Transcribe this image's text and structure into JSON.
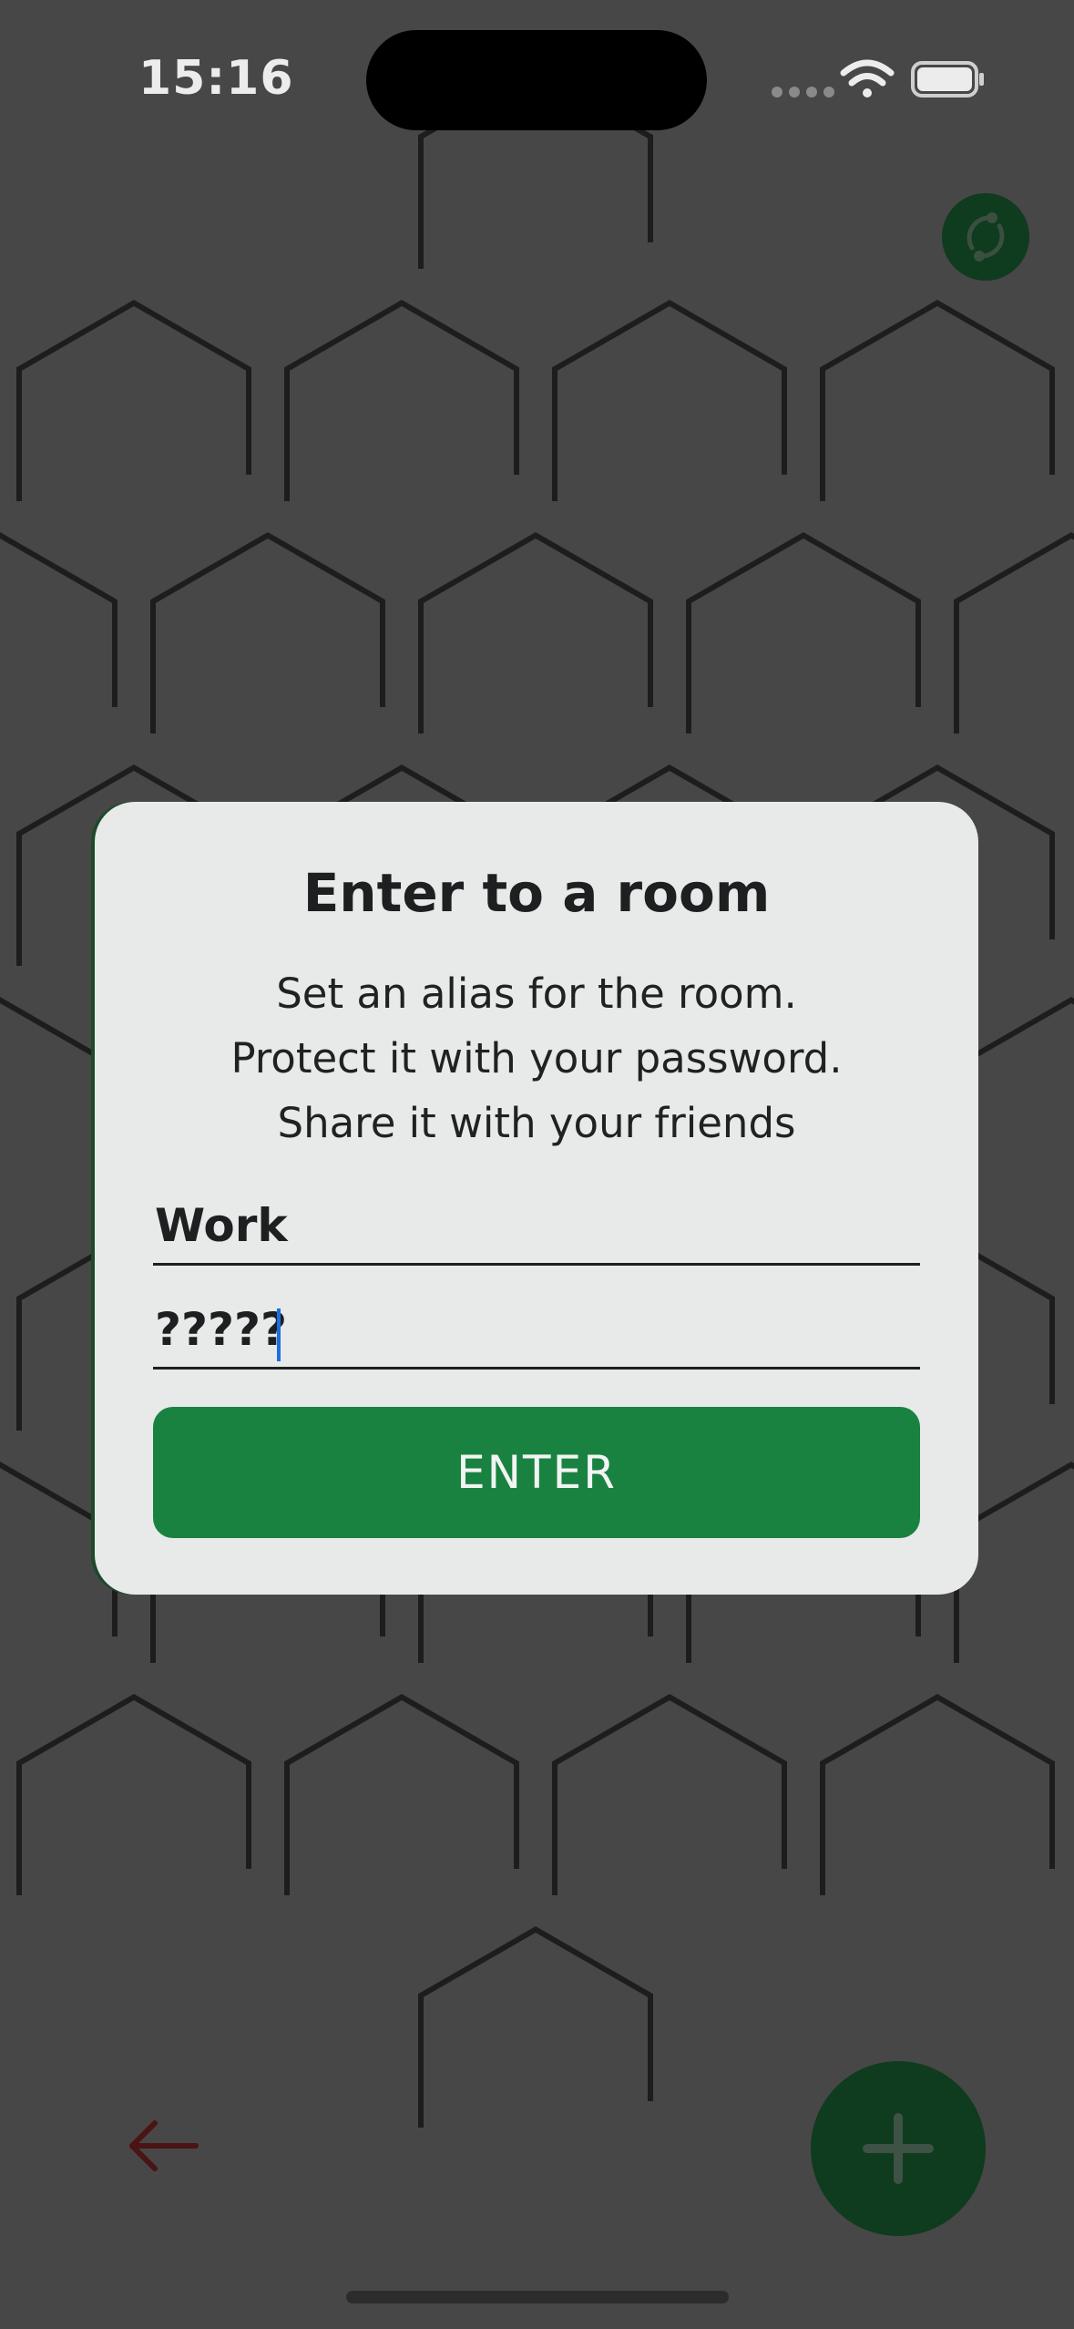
{
  "status_bar": {
    "time": "15:16",
    "icons": [
      "signal-dots-icon",
      "wifi-icon",
      "battery-icon"
    ]
  },
  "toolbar": {
    "sync_icon": "sync-icon"
  },
  "dialog": {
    "title": "Enter to a room",
    "description_lines": [
      "Set an alias for the room.",
      "Protect it with your password.",
      "Share it with your friends"
    ],
    "alias_field": {
      "value": "Work"
    },
    "password_field": {
      "value": "?????"
    },
    "enter_button_label": "ENTER"
  },
  "bottom_bar": {
    "back_icon": "arrow-left-icon",
    "add_icon": "plus-icon"
  },
  "colors": {
    "background": "#474747",
    "dialog": "#e8e9e9",
    "accent_green": "#198241",
    "dark_green": "#0f3b1e",
    "back_arrow": "#4a1414",
    "caret": "#1a6fe0"
  }
}
